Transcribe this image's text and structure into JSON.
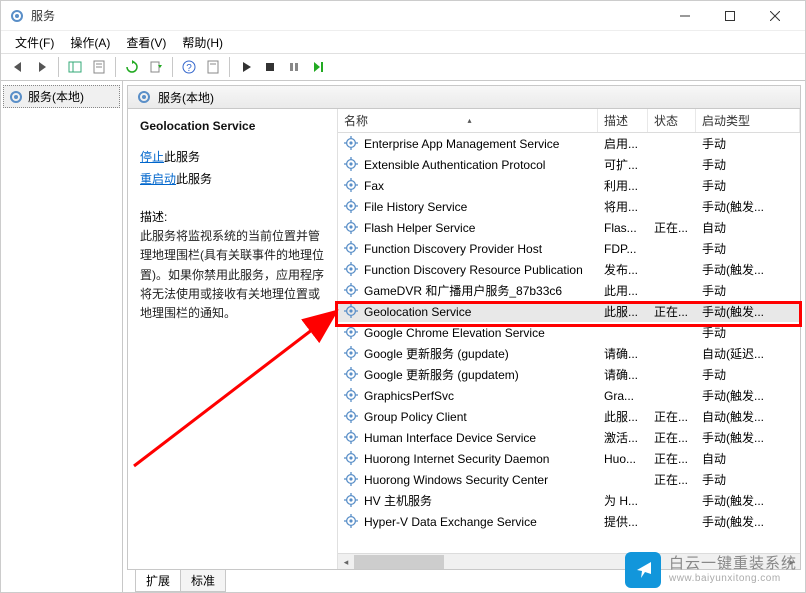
{
  "window": {
    "title": "服务",
    "min_tooltip": "最小化",
    "max_tooltip": "最大化",
    "close_tooltip": "关闭"
  },
  "menu": {
    "file": "文件(F)",
    "action": "操作(A)",
    "view": "查看(V)",
    "help": "帮助(H)"
  },
  "tree": {
    "root": "服务(本地)"
  },
  "panel_header": "服务(本地)",
  "detail": {
    "title": "Geolocation Service",
    "stop_link": "停止",
    "stop_suffix": "此服务",
    "restart_link": "重启动",
    "restart_suffix": "此服务",
    "desc_label": "描述:",
    "desc_text": "此服务将监视系统的当前位置并管理地理围栏(具有关联事件的地理位置)。如果你禁用此服务，应用程序将无法使用或接收有关地理位置或地理围栏的通知。"
  },
  "columns": {
    "name": "名称",
    "desc": "描述",
    "status": "状态",
    "startup": "启动类型"
  },
  "services": [
    {
      "name": "Enterprise App Management Service",
      "desc": "启用...",
      "status": "",
      "start": "手动"
    },
    {
      "name": "Extensible Authentication Protocol",
      "desc": "可扩...",
      "status": "",
      "start": "手动"
    },
    {
      "name": "Fax",
      "desc": "利用...",
      "status": "",
      "start": "手动"
    },
    {
      "name": "File History Service",
      "desc": "将用...",
      "status": "",
      "start": "手动(触发..."
    },
    {
      "name": "Flash Helper Service",
      "desc": "Flas...",
      "status": "正在...",
      "start": "自动"
    },
    {
      "name": "Function Discovery Provider Host",
      "desc": "FDP...",
      "status": "",
      "start": "手动"
    },
    {
      "name": "Function Discovery Resource Publication",
      "desc": "发布...",
      "status": "",
      "start": "手动(触发..."
    },
    {
      "name": "GameDVR 和广播用户服务_87b33c6",
      "desc": "此用...",
      "status": "",
      "start": "手动"
    },
    {
      "name": "Geolocation Service",
      "desc": "此服...",
      "status": "正在...",
      "start": "手动(触发...",
      "selected": true
    },
    {
      "name": "Google Chrome Elevation Service",
      "desc": "",
      "status": "",
      "start": "手动"
    },
    {
      "name": "Google 更新服务 (gupdate)",
      "desc": "请确...",
      "status": "",
      "start": "自动(延迟..."
    },
    {
      "name": "Google 更新服务 (gupdatem)",
      "desc": "请确...",
      "status": "",
      "start": "手动"
    },
    {
      "name": "GraphicsPerfSvc",
      "desc": "Gra...",
      "status": "",
      "start": "手动(触发..."
    },
    {
      "name": "Group Policy Client",
      "desc": "此服...",
      "status": "正在...",
      "start": "自动(触发..."
    },
    {
      "name": "Human Interface Device Service",
      "desc": "激活...",
      "status": "正在...",
      "start": "手动(触发..."
    },
    {
      "name": "Huorong Internet Security Daemon",
      "desc": "Huo...",
      "status": "正在...",
      "start": "自动"
    },
    {
      "name": "Huorong Windows Security Center",
      "desc": "",
      "status": "正在...",
      "start": "手动"
    },
    {
      "name": "HV 主机服务",
      "desc": "为 H...",
      "status": "",
      "start": "手动(触发..."
    },
    {
      "name": "Hyper-V Data Exchange Service",
      "desc": "提供...",
      "status": "",
      "start": "手动(触发..."
    }
  ],
  "tabs": {
    "extended": "扩展",
    "standard": "标准"
  },
  "watermark": {
    "line1": "白云一键重装系统",
    "line2": "www.baiyunxitong.com"
  }
}
